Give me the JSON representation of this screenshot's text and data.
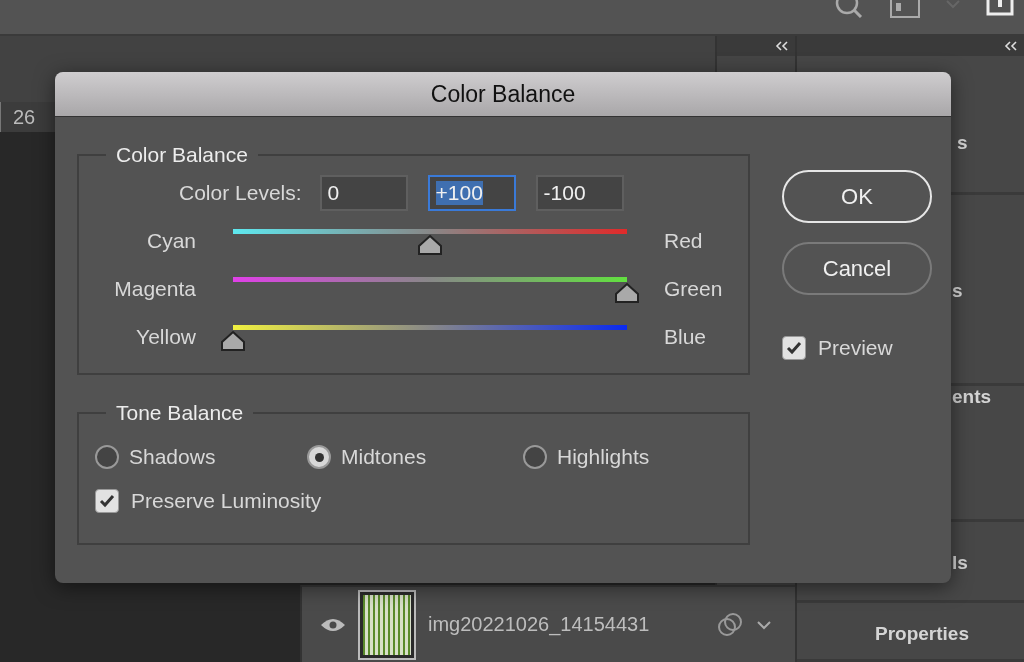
{
  "app": {
    "ruler": {
      "label": "26"
    },
    "panels": [
      {
        "label": "s"
      },
      {
        "label": "s"
      },
      {
        "label": "ents"
      },
      {
        "label": "ls"
      },
      {
        "label": "Properties"
      }
    ],
    "layer": {
      "name": "img20221026_14154431",
      "visible": true
    }
  },
  "dialog": {
    "title": "Color Balance",
    "color_balance": {
      "legend": "Color Balance",
      "levels_label": "Color Levels:",
      "levels": [
        {
          "value": "0",
          "selected": false
        },
        {
          "value": "+100",
          "selected": true
        },
        {
          "value": "-100",
          "selected": false
        }
      ],
      "sliders": [
        {
          "left": "Cyan",
          "right": "Red",
          "level": 0.5
        },
        {
          "left": "Magenta",
          "right": "Green",
          "level": 1
        },
        {
          "left": "Yellow",
          "right": "Blue",
          "level": 0
        }
      ]
    },
    "tone_balance": {
      "legend": "Tone Balance",
      "options": [
        {
          "label": "Shadows",
          "selected": false
        },
        {
          "label": "Midtones",
          "selected": true
        },
        {
          "label": "Highlights",
          "selected": false
        }
      ],
      "preserve": {
        "label": "Preserve Luminosity",
        "checked": true
      }
    },
    "buttons": [
      {
        "label": "OK",
        "default": true
      },
      {
        "label": "Cancel",
        "default": false
      }
    ],
    "preview": {
      "label": "Preview",
      "checked": true
    }
  }
}
